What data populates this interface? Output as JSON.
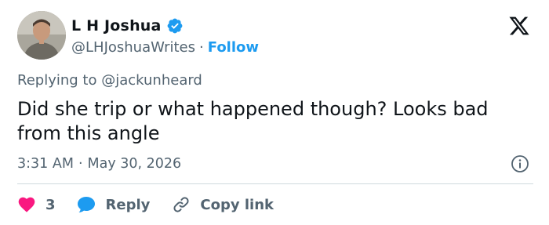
{
  "author": {
    "display_name": "L H Joshua",
    "handle": "@LHJoshuaWrites",
    "separator": "·",
    "follow_label": "Follow"
  },
  "reply_context": {
    "prefix": "Replying to",
    "mention": "@jackunheard"
  },
  "tweet": {
    "text": "Did she trip or what happened though? Looks bad from this angle"
  },
  "meta": {
    "time": "3:31 AM",
    "separator": "·",
    "date": "May 30, 2026"
  },
  "actions": {
    "like_count": "3",
    "reply_label": "Reply",
    "copy_link_label": "Copy link"
  },
  "icons": {
    "verified": "verified-badge-icon",
    "logo": "x-logo-icon",
    "info": "info-icon",
    "like": "heart-icon",
    "reply": "reply-bubble-icon",
    "copy": "link-icon"
  },
  "colors": {
    "text": "#0f1419",
    "secondary": "#536471",
    "accent": "#1d9bf0",
    "like": "#f91880",
    "divider": "#cfd9de"
  }
}
